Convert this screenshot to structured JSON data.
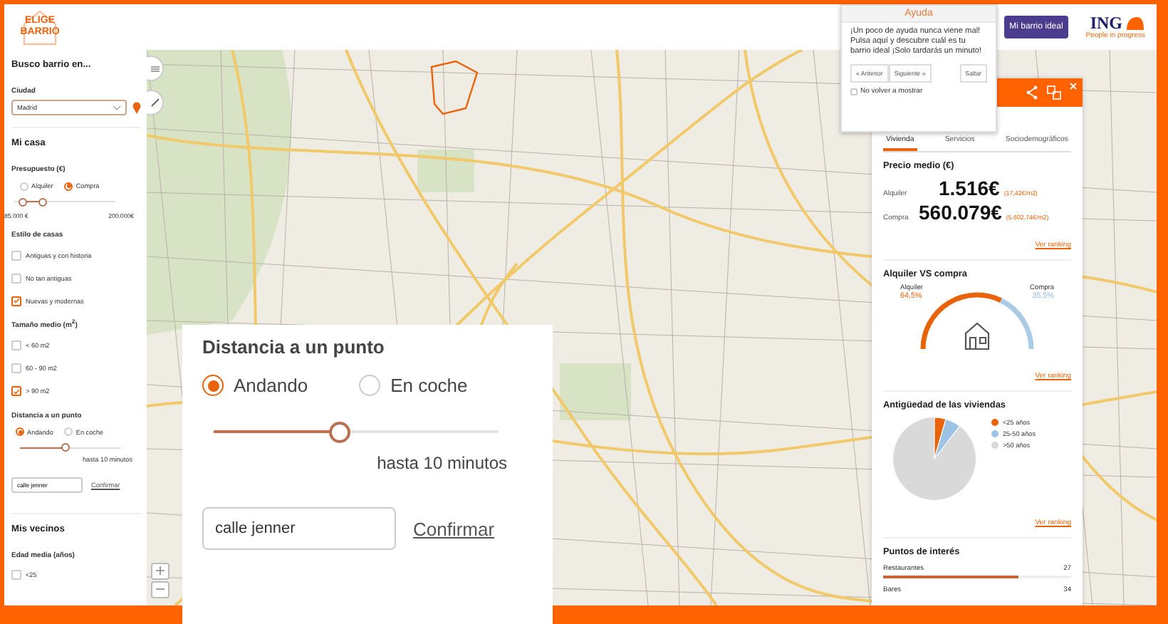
{
  "header": {
    "logo": {
      "line_1": "ELIGE",
      "line_2": "BARRIO"
    },
    "ideal_button": "Mi barrio ideal",
    "brand": {
      "name": "ING",
      "slogan": "People in progress"
    }
  },
  "sidebar": {
    "title": "Busco barrio en...",
    "city": {
      "label": "Ciudad",
      "value": "Madrid"
    },
    "home": {
      "title": "Mi casa",
      "budget": {
        "label": "Presupuesto (€)",
        "options": [
          {
            "label": "Alquiler",
            "selected": false
          },
          {
            "label": "Compra",
            "selected": true
          }
        ],
        "min_handle": {
          "level": 0.08
        },
        "max_handle": {
          "level": 0.28
        },
        "min_label": "85.000 €",
        "max_label": "200.000€"
      },
      "style": {
        "label": "Estilo de casas",
        "options": [
          {
            "label": "Antiguas y con historia",
            "checked": false
          },
          {
            "label": "No tan antiguas",
            "checked": false
          },
          {
            "label": "Nuevas y modernas",
            "checked": true
          }
        ]
      },
      "size": {
        "label": "Tamaño medio (m$^{2}$)",
        "options": [
          {
            "label": "< 60 m2",
            "checked": false
          },
          {
            "label": "60 - 90 m2",
            "checked": false
          },
          {
            "label": "> 90 m2",
            "checked": true
          }
        ]
      },
      "distance": {
        "label": "Distancia a un punto",
        "modes": [
          {
            "label": "Andando",
            "selected": true
          },
          {
            "label": "En coche",
            "selected": false
          }
        ],
        "level": 0.45,
        "reading": "hasta 10 minutos",
        "address": "calle jenner",
        "confirm": "Confirmar"
      }
    },
    "neighbours": {
      "title": "Mis vecinos",
      "age": {
        "label": "Edad media (años)",
        "options": [
          {
            "label": "<25",
            "checked": false
          }
        ]
      }
    }
  },
  "magnifier": {
    "label": "Distancia a un punto",
    "modes": [
      {
        "label": "Andando",
        "selected": true
      },
      {
        "label": "En coche",
        "selected": false
      }
    ],
    "level": 0.44,
    "reading": "hasta 10 minutos",
    "address": "calle jenner",
    "confirm": "Confirmar"
  },
  "help_popup": {
    "title": "Ayuda",
    "text": "¡Un poco de ayuda nunca viene mal! Pulsa aquí y descubre cuál es tu barrio ideal ¡Solo tardarás un minuto!",
    "buttons": [
      "« Anterior",
      "Siguiente »"
    ],
    "skip": "Saltar",
    "dont_show": {
      "label": "No volver a mostrar",
      "checked": false
    }
  },
  "district_panel": {
    "tabs": [
      {
        "label": "Vivienda",
        "selected": true
      },
      {
        "label": "Servicios",
        "selected": false
      },
      {
        "label": "Sociodemográficos",
        "selected": false
      }
    ],
    "price": {
      "title": "Precio medio (€)",
      "rows": [
        {
          "label": "Alquiler",
          "value": "1.516€",
          "per_m2": "(17,42€/m2)"
        },
        {
          "label": "Compra",
          "value": "560.079€",
          "per_m2": "(5.602,74€/m2)"
        }
      ],
      "link": "Ver ranking"
    },
    "rent_vs_buy": {
      "title": "Alquiler VS compra",
      "left": {
        "label": "Alquiler",
        "value": "64,5%"
      },
      "right": {
        "label": "Compra",
        "value": "35,5%"
      },
      "level": 0.645,
      "link": "Ver ranking"
    },
    "age": {
      "title": "Antigüedad de las viviendas",
      "legend": [
        {
          "label": "<25 años",
          "color": "#e8630a"
        },
        {
          "label": "25-50 años",
          "color": "#9cc3e4"
        },
        {
          "label": ">50 años",
          "color": "#d9d9d9"
        }
      ],
      "link": "Ver ranking"
    },
    "interest": {
      "title": "Puntos de interés",
      "rows": [
        {
          "label": "Restaurantes",
          "count": "27",
          "level": 0.72
        },
        {
          "label": "Bares",
          "count": "34"
        }
      ]
    }
  }
}
